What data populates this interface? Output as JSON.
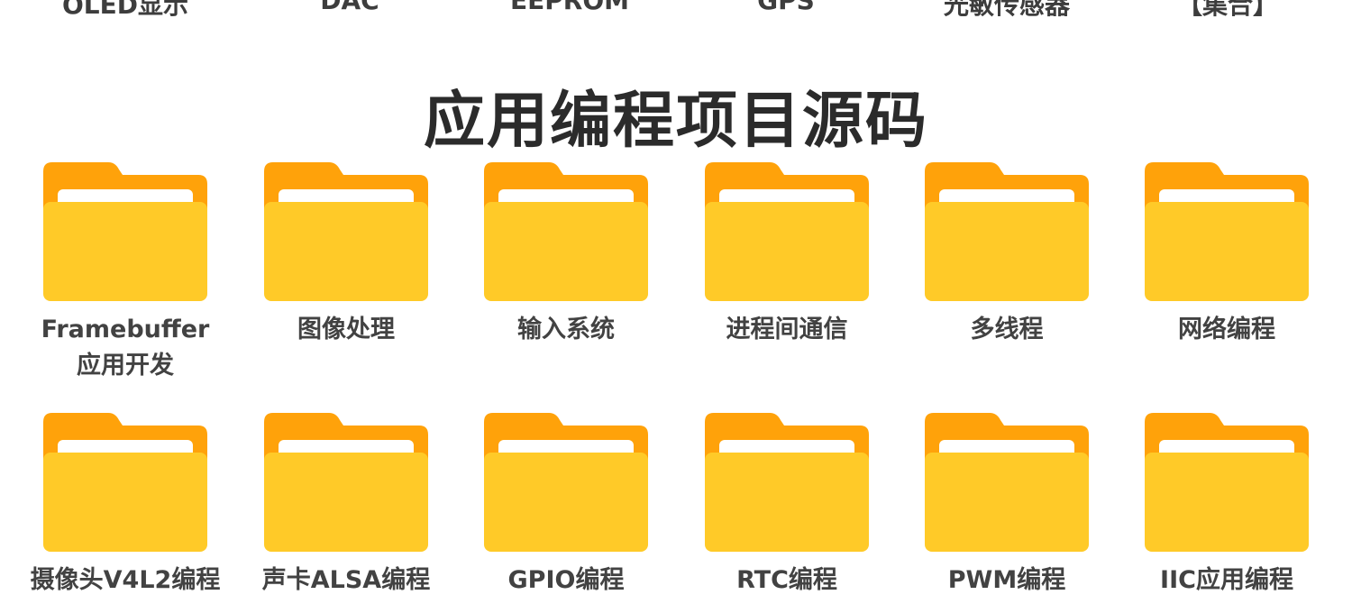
{
  "top_row": {
    "labels": [
      "OLED显示",
      "DAC",
      "EEPROM",
      "GPS",
      "光敏传感器",
      "【集合】"
    ]
  },
  "section": {
    "title": "应用编程项目源码"
  },
  "folders": [
    {
      "line1": "Framebuffer",
      "line2": "应用开发"
    },
    {
      "line1": "图像处理",
      "line2": ""
    },
    {
      "line1": "输入系统",
      "line2": ""
    },
    {
      "line1": "进程间通信",
      "line2": ""
    },
    {
      "line1": "多线程",
      "line2": ""
    },
    {
      "line1": "网络编程",
      "line2": ""
    },
    {
      "line1": "摄像头V4L2编程",
      "line2": ""
    },
    {
      "line1": "声卡ALSA编程",
      "line2": ""
    },
    {
      "line1": "GPIO编程",
      "line2": ""
    },
    {
      "line1": "RTC编程",
      "line2": ""
    },
    {
      "line1": "PWM编程",
      "line2": ""
    },
    {
      "line1": "IIC应用编程",
      "line2": ""
    }
  ],
  "colors": {
    "folder_back": "#FFA20A",
    "folder_front": "#FFCA28",
    "folder_paper": "#FFFFFF"
  },
  "icons": {
    "folder": "folder-icon"
  }
}
